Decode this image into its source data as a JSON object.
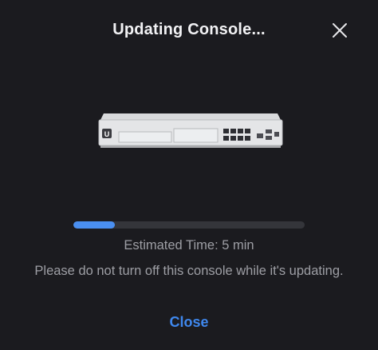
{
  "dialog": {
    "title": "Updating Console...",
    "close_icon": "close-icon",
    "device_image": "console-device-image",
    "device_logo_text": "U",
    "progress": {
      "percent": 18,
      "track_color": "#34353a",
      "fill_color": "#4a8ff0"
    },
    "estimated_time": "Estimated Time: 5 min",
    "warning": "Please do not turn off this console while it's updating.",
    "close_label": "Close",
    "accent_color": "#3f88ee"
  }
}
